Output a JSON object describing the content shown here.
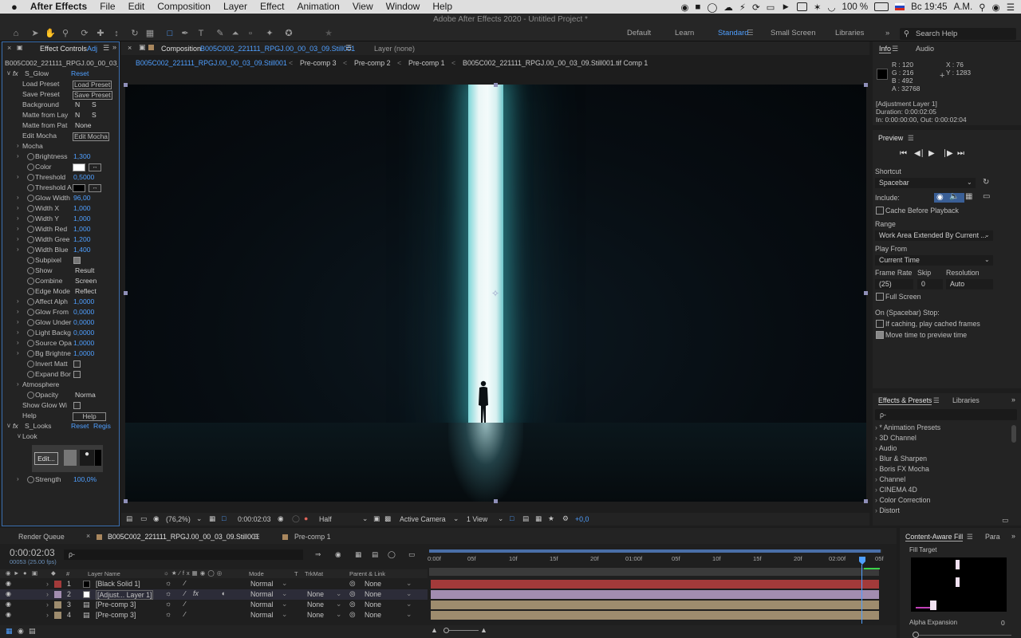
{
  "menubar": {
    "app_name": "After Effects",
    "menus": [
      "File",
      "Edit",
      "Composition",
      "Layer",
      "Effect",
      "Animation",
      "View",
      "Window",
      "Help"
    ],
    "battery": "100 %",
    "clock": "Вс 19:45",
    "user": "A.M."
  },
  "title_bar": {
    "title": "Adobe After Effects 2020 - Untitled Project *"
  },
  "workspaces": {
    "items": [
      "Default",
      "Learn",
      "Standard",
      "Small Screen",
      "Libraries"
    ],
    "active": "Standard",
    "search_placeholder": "Search Help"
  },
  "effect_controls": {
    "tab_label": "Effect Controls",
    "tab_suffix": "Adj",
    "layer_path": "B005C002_221111_RPGJ.00_00_03_0",
    "effect1_name": "S_Glow",
    "reset": "Reset",
    "load_preset_label": "Load Preset",
    "load_preset_btn": "Load Preset",
    "save_preset_label": "Save Preset",
    "save_preset_btn": "Save Preset",
    "background_label": "Background",
    "background_v1": "N",
    "background_v2": "S",
    "matte_layer_label": "Matte from Lay",
    "matte_layer_v1": "N",
    "matte_layer_v2": "S",
    "matte_path_label": "Matte from Pat",
    "matte_path_val": "None",
    "edit_mocha_label": "Edit Mocha",
    "edit_mocha_btn": "Edit Mocha",
    "mocha_group": "Mocha",
    "brightness_label": "Brightness",
    "brightness_val": "1,300",
    "color_label": "Color",
    "threshold_label": "Threshold",
    "threshold_val": "0,5000",
    "threshold_a_label": "Threshold A",
    "glow_width_label": "Glow Width",
    "glow_width_val": "96,00",
    "width_x_label": "Width X",
    "width_x_val": "1,000",
    "width_y_label": "Width Y",
    "width_y_val": "1,000",
    "width_red_label": "Width Red",
    "width_red_val": "1,000",
    "width_green_label": "Width Gree",
    "width_green_val": "1,200",
    "width_blue_label": "Width Blue",
    "width_blue_val": "1,400",
    "subpixel_label": "Subpixel",
    "show_label": "Show",
    "show_val": "Result",
    "combine_label": "Combine",
    "combine_val": "Screen",
    "edge_mode_label": "Edge Mode",
    "edge_mode_val": "Reflect",
    "affect_alpha_label": "Affect Alph",
    "affect_alpha_val": "1,0000",
    "glow_from_label": "Glow From",
    "glow_from_val": "0,0000",
    "glow_under_label": "Glow Under",
    "glow_under_val": "0,0000",
    "light_bg_label": "Light Backg",
    "light_bg_val": "0,0000",
    "source_opacity_label": "Source Opa",
    "source_opacity_val": "1,0000",
    "bg_brightness_label": "Bg Brightne",
    "bg_brightness_val": "1,0000",
    "invert_matte_label": "Invert Matt",
    "expand_border_label": "Expand Bor",
    "atmosphere_group": "Atmosphere",
    "opacity_label": "Opacity",
    "opacity_val": "Norma",
    "show_glow_label": "Show Glow Wi",
    "help_label": "Help",
    "help_btn": "Help",
    "effect2_name": "S_Looks",
    "effect2_reset": "Reset",
    "effect2_register": "Regis",
    "look_group": "Look",
    "edit_btn": "Edit...",
    "strength_label": "Strength",
    "strength_val": "100,0%"
  },
  "composition": {
    "tab_prefix": "Composition",
    "tab_name": "B005C002_221111_RPGJ.00_00_03_09.Still001",
    "layer_tab": "Layer (none)",
    "breadcrumbs": [
      "B005C002_221111_RPGJ.00_00_03_09.Still001",
      "Pre-comp 3",
      "Pre-comp 2",
      "Pre-comp 1",
      "B005C002_221111_RPGJ.00_00_03_09.Still001.tif Comp 1"
    ],
    "zoom": "(76,2%)",
    "timecode": "0:00:02:03",
    "resolution": "Half",
    "camera": "Active Camera",
    "views": "1 View",
    "exposure": "+0,0"
  },
  "info_panel": {
    "tab_info": "Info",
    "tab_audio": "Audio",
    "r": "R : 120",
    "g": "G : 216",
    "b": "B : 492",
    "a": "A : 32768",
    "x": "X : 76",
    "y": "Y : 1283",
    "layer": "[Adjustment Layer 1]",
    "duration": "Duration: 0:00:02:05",
    "in_out": "In: 0:00:00:00, Out: 0:00:02:04"
  },
  "preview_panel": {
    "title": "Preview",
    "shortcut_label": "Shortcut",
    "shortcut_val": "Spacebar",
    "include_label": "Include:",
    "cache_label": "Cache Before Playback",
    "range_label": "Range",
    "range_val": "Work Area Extended By Current ...",
    "play_from_label": "Play From",
    "play_from_val": "Current Time",
    "frame_rate_label": "Frame Rate",
    "skip_label": "Skip",
    "resolution_label": "Resolution",
    "frame_rate_val": "(25)",
    "skip_val": "0",
    "resolution_val": "Auto",
    "full_screen_label": "Full Screen",
    "stop_label": "On (Spacebar) Stop:",
    "if_caching_label": "If caching, play cached frames",
    "move_time_label": "Move time to preview time"
  },
  "effects_presets": {
    "tab_label": "Effects & Presets",
    "tab_libraries": "Libraries",
    "search_placeholder": "ρ-",
    "items": [
      "* Animation Presets",
      "3D Channel",
      "Audio",
      "Blur & Sharpen",
      "Boris FX Mocha",
      "Channel",
      "CINEMA 4D",
      "Color Correction",
      "Distort"
    ]
  },
  "timeline": {
    "render_queue": "Render Queue",
    "comp_tab": "B005C002_221111_RPGJ.00_00_03_09.Still001",
    "precomp_tab": "Pre-comp 1",
    "timecode": "0:00:02:03",
    "frames": "00053 (25.00 fps)",
    "search_placeholder": "ρ-",
    "ruler": [
      "0:00f",
      "05f",
      "10f",
      "15f",
      "20f",
      "01:00f",
      "05f",
      "10f",
      "15f",
      "20f",
      "02:00f",
      "05f"
    ],
    "columns": {
      "num": "#",
      "layer_name": "Layer Name",
      "mode": "Mode",
      "t": "T",
      "trkmat": "TrkMat",
      "parent": "Parent & Link"
    },
    "layers": [
      {
        "num": "1",
        "name": "[Black Solid 1]",
        "mode": "Normal",
        "trkmat": "",
        "parent": "None"
      },
      {
        "num": "2",
        "name": "[Adjust... Layer 1]",
        "mode": "Normal",
        "trkmat": "None",
        "parent": "None"
      },
      {
        "num": "3",
        "name": "[Pre-comp 3]",
        "mode": "Normal",
        "trkmat": "None",
        "parent": "None"
      },
      {
        "num": "4",
        "name": "[Pre-comp 3]",
        "mode": "Normal",
        "trkmat": "None",
        "parent": "None"
      }
    ],
    "layer_colors": [
      "#a33a3a",
      "#a28db0",
      "#9e8c6e",
      "#9e8c6e"
    ]
  },
  "content_aware": {
    "tab_label": "Content-Aware Fill",
    "tab_para": "Para",
    "fill_target": "Fill Target",
    "alpha_expansion": "Alpha Expansion",
    "alpha_val": "0"
  }
}
